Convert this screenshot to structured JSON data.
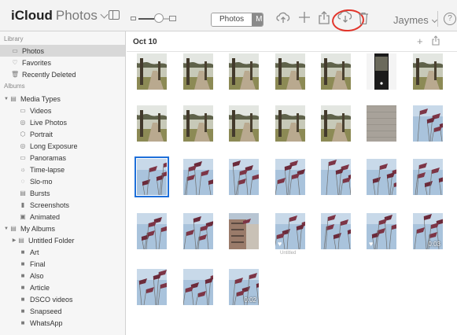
{
  "header": {
    "brand": "iCloud",
    "app_name": "Photos",
    "segment_active": "Photos",
    "segment_other": "M",
    "user": "Jaymes",
    "help": "?"
  },
  "colors": {
    "accent": "#1e6fd9",
    "highlight_circle": "#e2352b",
    "sidebar_selected": "#d8d8d8"
  },
  "sidebar": {
    "library_label": "Library",
    "library": [
      {
        "label": "Photos",
        "icon": "photos-icon",
        "selected": true
      },
      {
        "label": "Favorites",
        "icon": "heart-icon"
      },
      {
        "label": "Recently Deleted",
        "icon": "trash-icon"
      }
    ],
    "albums_label": "Albums",
    "media_types": {
      "label": "Media Types",
      "icon": "folder-icon",
      "expanded": true
    },
    "media_items": [
      {
        "label": "Videos",
        "icon": "video-icon"
      },
      {
        "label": "Live Photos",
        "icon": "live-photo-icon"
      },
      {
        "label": "Portrait",
        "icon": "portrait-icon"
      },
      {
        "label": "Long Exposure",
        "icon": "long-exposure-icon"
      },
      {
        "label": "Panoramas",
        "icon": "panorama-icon"
      },
      {
        "label": "Time-lapse",
        "icon": "timelapse-icon"
      },
      {
        "label": "Slo-mo",
        "icon": "slomo-icon"
      },
      {
        "label": "Bursts",
        "icon": "bursts-icon"
      },
      {
        "label": "Screenshots",
        "icon": "screenshot-icon"
      },
      {
        "label": "Animated",
        "icon": "animated-icon"
      }
    ],
    "my_albums": {
      "label": "My Albums",
      "icon": "folder-icon",
      "expanded": true
    },
    "album_items": [
      {
        "label": "Untitled Folder",
        "icon": "folder-icon",
        "collapsed": true
      },
      {
        "label": "Art",
        "icon": "album-icon"
      },
      {
        "label": "Final",
        "icon": "album-icon"
      },
      {
        "label": "Also",
        "icon": "album-icon"
      },
      {
        "label": "Article",
        "icon": "album-icon"
      },
      {
        "label": "DSCO videos",
        "icon": "album-icon"
      },
      {
        "label": "Snapseed",
        "icon": "album-icon"
      },
      {
        "label": "WhatsApp",
        "icon": "album-icon"
      }
    ]
  },
  "main": {
    "date": "Oct 10",
    "photos": [
      {
        "type": "park"
      },
      {
        "type": "park"
      },
      {
        "type": "park"
      },
      {
        "type": "park"
      },
      {
        "type": "park"
      },
      {
        "type": "phone"
      },
      {
        "type": "park"
      },
      {
        "type": "park"
      },
      {
        "type": "park"
      },
      {
        "type": "park"
      },
      {
        "type": "park"
      },
      {
        "type": "park"
      },
      {
        "type": "wall"
      },
      {
        "type": "flags"
      },
      {
        "type": "flags",
        "selected": true
      },
      {
        "type": "flags"
      },
      {
        "type": "flags"
      },
      {
        "type": "flags"
      },
      {
        "type": "flags"
      },
      {
        "type": "flags"
      },
      {
        "type": "flags"
      },
      {
        "type": "flags"
      },
      {
        "type": "flags"
      },
      {
        "type": "building"
      },
      {
        "type": "flags",
        "favorite": true,
        "caption": "Untitled"
      },
      {
        "type": "flags"
      },
      {
        "type": "flags",
        "favorite": true
      },
      {
        "type": "flags",
        "duration": "0:03"
      },
      {
        "type": "flags"
      },
      {
        "type": "flags"
      },
      {
        "type": "flags",
        "duration": "0:02"
      }
    ]
  }
}
